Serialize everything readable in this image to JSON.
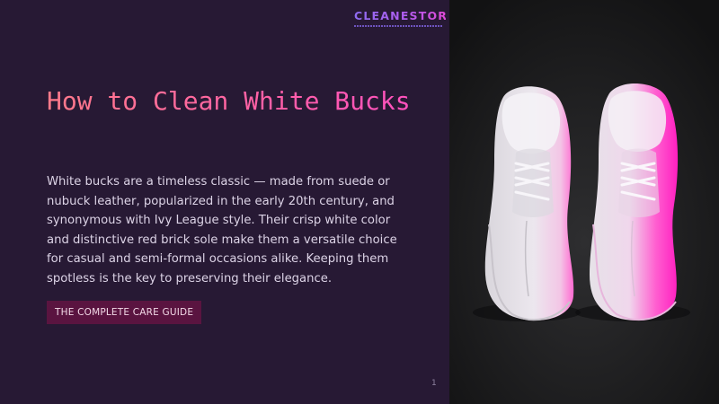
{
  "brand": {
    "name": "CLEANESTOR",
    "colors": {
      "primary": "#8e6cf0",
      "accent": "#e04ad8"
    }
  },
  "slide": {
    "title": "How to Clean White Bucks",
    "body": "White bucks are a timeless classic — made from suede or nubuck leather, popularized in the early 20th century, and synonymous with Ivy League style. Their crisp white color and distinctive red brick sole make them a versatile choice for casual and semi-formal occasions alike. Keeping them spotless is the key to preserving their elegance.",
    "cta_label": "THE COMPLETE CARE GUIDE",
    "page_number": "1"
  },
  "image": {
    "subject": "pair-of-white-buck-shoes",
    "colors": {
      "background": "#1c1c1e",
      "shoe": "#e8e6ea",
      "highlight": "#ff2fc8"
    }
  }
}
